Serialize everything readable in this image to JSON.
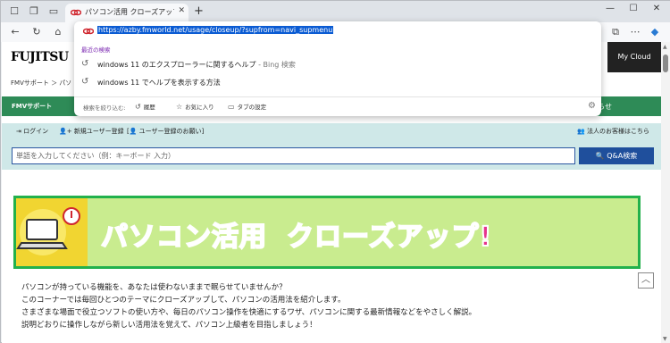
{
  "browser": {
    "tab_title": "パソコン活用 クローズアップ！ - FMVサポート",
    "tab_close": "✕",
    "new_tab": "+",
    "window_controls": {
      "minimize": "—",
      "maximize": "☐",
      "close": "✕"
    }
  },
  "omnibox": {
    "url": "https://azby.fmworld.net/usage/closeup/?supfrom=navi_supmenu",
    "recent_header": "最近の検索",
    "suggestions": [
      {
        "text": "windows 11 のエクスプローラーに関するヘルプ",
        "source": " - Bing 検索"
      },
      {
        "text": "windows 11 でヘルプを表示する方法",
        "source": ""
      }
    ],
    "filter": {
      "label": "検索を絞り込む:",
      "history": "履歴",
      "favorites": "お気に入り",
      "tab_settings": "タブの設定"
    }
  },
  "site": {
    "logo": "FUJITSU",
    "mycloud": "My Cloud",
    "breadcrumb": "FMVサポート ＞ パソ",
    "nav_label": "FMVサポート",
    "nav_right": "らせ",
    "login": "ログイン",
    "register": "新規ユーザー登録",
    "register_request": "ユーザー登録のお願い",
    "corporate": "法人のお客様はこちら",
    "search_placeholder": "単語を入力してください（例：キーボード 入力）",
    "search_button": "Q&A検索"
  },
  "banner": {
    "title_part1": "パソコン活用",
    "title_part2": "クローズアップ!"
  },
  "intro": [
    "パソコンが持っている機能を、あなたは使わないままで眠らせていませんか？",
    "このコーナーでは毎回ひとつのテーマにクローズアップして、パソコンの活用法を紹介します。",
    "さまざまな場面で役立つソフトの使い方や、毎日のパソコン操作を快適にするワザ、パソコンに関する最新情報などをやさしく解説。",
    "説明どおりに操作しながら新しい活用法を覚えて、パソコン上級者を目指しましょう！"
  ],
  "colors": {
    "accent_green": "#2e8b57",
    "search_button": "#1f4f9c",
    "banner_border": "#22b14c",
    "url_highlight": "#0a5bd3"
  }
}
